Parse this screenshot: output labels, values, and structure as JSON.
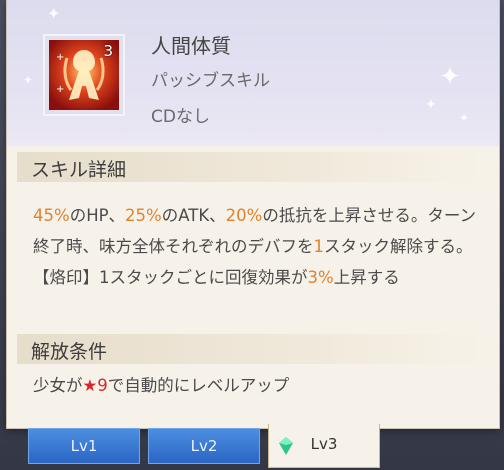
{
  "skill": {
    "icon_level": "3",
    "name": "人間体質",
    "type": "パッシブスキル",
    "cd": "CDなし"
  },
  "details": {
    "title": "スキル詳細",
    "segments": [
      {
        "text": "45%",
        "highlight": true
      },
      {
        "text": "のHP、",
        "highlight": false
      },
      {
        "text": "25%",
        "highlight": true
      },
      {
        "text": "のATK、",
        "highlight": false
      },
      {
        "text": "20%",
        "highlight": true
      },
      {
        "text": "の抵抗を上昇させる。ターン終了時、味方全体それぞれのデバフを",
        "highlight": false
      },
      {
        "text": "1",
        "highlight": true
      },
      {
        "text": "スタック解除する。【烙印】1スタックごとに回復効果が",
        "highlight": false
      },
      {
        "text": "3%",
        "highlight": true
      },
      {
        "text": "上昇する",
        "highlight": false
      }
    ]
  },
  "unlock": {
    "title": "解放条件",
    "prefix": "少女が",
    "star": "★",
    "star_count": "9",
    "suffix": "で自動的にレベルアップ"
  },
  "tabs": [
    {
      "label": "Lv1",
      "active": false
    },
    {
      "label": "Lv2",
      "active": false
    },
    {
      "label": "Lv3",
      "active": true
    }
  ],
  "colors": {
    "highlight": "#e0822e",
    "star": "#d8272a",
    "tab_blue": "#3a7bd5"
  }
}
